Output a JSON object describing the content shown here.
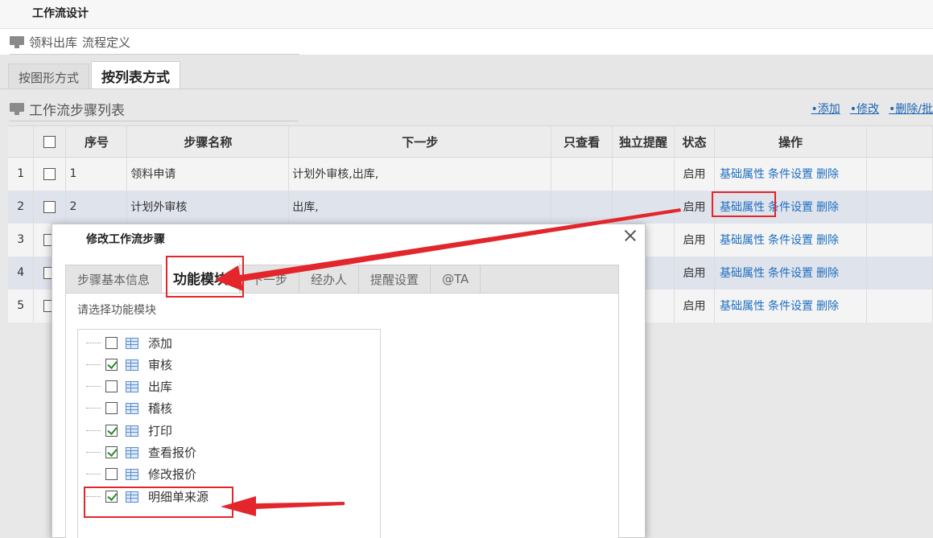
{
  "app": {
    "title": "工作流设计"
  },
  "breadcrumb": {
    "workflow_name": "领料出库",
    "page_name": "流程定义"
  },
  "view_tabs": [
    {
      "label": "按图形方式",
      "active": false
    },
    {
      "label": "按列表方式",
      "active": true
    }
  ],
  "section": {
    "title": "工作流步骤列表"
  },
  "toolbar": {
    "add": "•添加",
    "edit": "•修改",
    "delete": "•删除/批"
  },
  "table": {
    "columns": [
      "序号",
      "步骤名称",
      "下一步",
      "只查看",
      "独立提醒",
      "状态",
      "操作"
    ],
    "rows": [
      {
        "row_no": "1",
        "seq": "1",
        "name": "领料申请",
        "next": "计划外审核,出库,",
        "status": "启用"
      },
      {
        "row_no": "2",
        "seq": "2",
        "name": "计划外审核",
        "next": "出库,",
        "status": "启用"
      },
      {
        "row_no": "3",
        "seq": "",
        "name": "",
        "next": "",
        "status": "启用"
      },
      {
        "row_no": "4",
        "seq": "",
        "name": "",
        "next": "",
        "status": "启用"
      },
      {
        "row_no": "5",
        "seq": "",
        "name": "",
        "next": "",
        "status": "启用"
      }
    ],
    "op_links": {
      "basic": "基础属性",
      "condition": "条件设置",
      "delete": "删除"
    }
  },
  "modal": {
    "title": "修改工作流步骤",
    "tabs": [
      {
        "label": "步骤基本信息",
        "active": false
      },
      {
        "label": "功能模块",
        "active": true
      },
      {
        "label": "下一步",
        "active": false
      },
      {
        "label": "经办人",
        "active": false
      },
      {
        "label": "提醒设置",
        "active": false
      },
      {
        "label": "@TA",
        "active": false
      }
    ],
    "hint": "请选择功能模块",
    "modules": [
      {
        "label": "添加",
        "checked": false
      },
      {
        "label": "审核",
        "checked": true
      },
      {
        "label": "出库",
        "checked": false
      },
      {
        "label": "稽核",
        "checked": false
      },
      {
        "label": "打印",
        "checked": true
      },
      {
        "label": "查看报价",
        "checked": true
      },
      {
        "label": "修改报价",
        "checked": false
      },
      {
        "label": "明细单来源",
        "checked": true
      }
    ]
  },
  "colors": {
    "accent_red": "#e2262b",
    "link_blue": "#1f6fc0"
  }
}
